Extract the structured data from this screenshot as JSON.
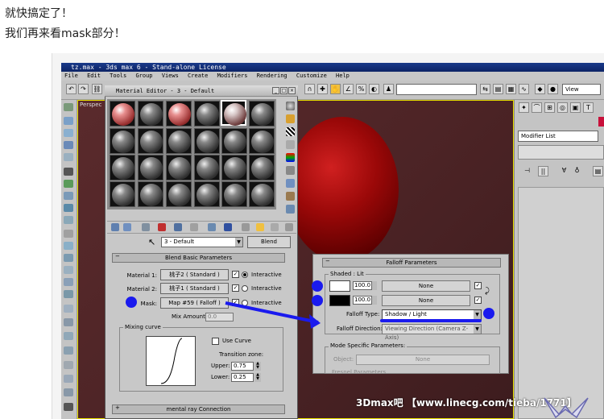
{
  "post": {
    "line1": "就快搞定了！",
    "line2": "我们再来看mask部分！"
  },
  "app": {
    "title": "tz.max - 3ds max 6 - Stand-alone License",
    "menu": [
      "File",
      "Edit",
      "Tools",
      "Group",
      "Views",
      "Create",
      "Modifiers",
      "Rendering",
      "Customize",
      "Help"
    ],
    "view_dropdown": "View",
    "viewport_label": "Perspec",
    "modifier_list": "Modifier List"
  },
  "material_editor": {
    "title": "Material Editor - 3 - Default",
    "name_field": "3 - Default",
    "type_button": "Blend",
    "rollout_title": "Blend Basic Parameters",
    "rows": [
      {
        "label": "Material 1:",
        "button": "桃子2 ( Standard )",
        "radio": "Interactive"
      },
      {
        "label": "Material 2:",
        "button": "桃子1 ( Standard )",
        "radio": "Interactive"
      },
      {
        "label": "Mask:",
        "button": "Map #59 ( Falloff )",
        "radio": "Interactive"
      }
    ],
    "mix_amount_label": "Mix Amount:",
    "mix_amount_value": "0.0",
    "mixing_curve_label": "Mixing curve",
    "use_curve_label": "Use Curve",
    "transition_zone_label": "Transition zone:",
    "upper_label": "Upper:",
    "upper_value": "0.75",
    "lower_label": "Lower:",
    "lower_value": "0.25",
    "mental_ray_rollout": "mental ray Connection"
  },
  "falloff": {
    "rollout_title": "Falloff Parameters",
    "group_label": "Shaded : Lit",
    "row1_pct": "100.0",
    "row1_map": "None",
    "row2_pct": "100.0",
    "row2_map": "None",
    "falloff_type_label": "Falloff Type:",
    "falloff_type_value": "Shadow / Light",
    "falloff_direction_label": "Falloff Direction:",
    "falloff_direction_value": "Viewing Direction (Camera Z-Axis)",
    "mode_label": "Mode Specific Parameters:",
    "object_label": "Object:",
    "object_value": "None",
    "faded_text": "Fresnel Parameters"
  },
  "watermark": "3Dmax吧 【www.linecg.com/tieba/1771】",
  "colors": {
    "highlight_blue": "#1a1aee",
    "viewport_bg": "#4d2426",
    "ball_red": "#9a0808"
  }
}
